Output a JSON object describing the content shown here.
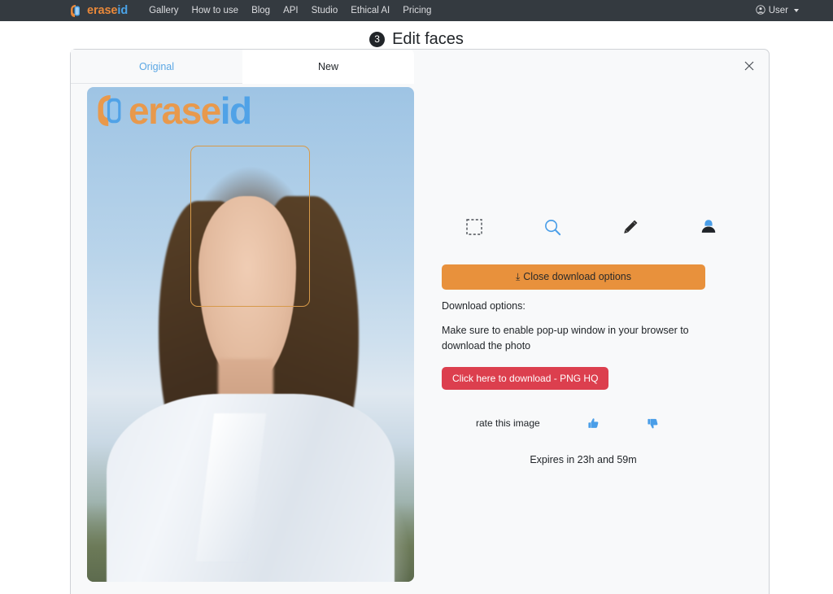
{
  "navbar": {
    "brand": {
      "erase": "erase",
      "id": "id",
      "logo_icon": "eraseid-logo-icon"
    },
    "links": [
      {
        "label": "Gallery"
      },
      {
        "label": "How to use"
      },
      {
        "label": "Blog"
      },
      {
        "label": "API"
      },
      {
        "label": "Studio"
      },
      {
        "label": "Ethical AI"
      },
      {
        "label": "Pricing"
      }
    ],
    "user": {
      "label": "User",
      "icon": "user-circle-icon",
      "caret": "chevron-down-icon"
    },
    "bg_color": "#343a40"
  },
  "page": {
    "step_number": "3",
    "title": "Edit faces"
  },
  "panel": {
    "close_icon": "close-icon",
    "tabs": [
      {
        "label": "Original",
        "active": false
      },
      {
        "label": "New",
        "active": true
      }
    ],
    "image": {
      "watermark": {
        "erase": "erase",
        "id": "id",
        "logo_icon": "eraseid-logo-icon"
      },
      "face_box": {
        "name": "face-detection-box",
        "color": "#d79a4a"
      }
    },
    "tools": [
      {
        "icon": "selection-box-icon",
        "name": "select-tool"
      },
      {
        "icon": "magnifier-icon",
        "name": "zoom-tool"
      },
      {
        "icon": "pencil-icon",
        "name": "edit-tool"
      },
      {
        "icon": "person-icon",
        "name": "face-tool"
      }
    ],
    "download": {
      "close_options_label": "Close download options",
      "download_icon": "download-icon",
      "options_label": "Download options:",
      "help_text": "Make sure to enable pop-up window in your browser to download the photo",
      "download_button_label": "Click here to download - PNG HQ",
      "orange_color": "#e8913c",
      "red_color": "#dc3f4e"
    },
    "rating": {
      "label": "rate this image",
      "thumbs_up_icon": "thumbs-up-icon",
      "thumbs_down_icon": "thumbs-down-icon",
      "accent_color": "#4a9ee8"
    },
    "expires_text": "Expires in 23h and 59m"
  }
}
